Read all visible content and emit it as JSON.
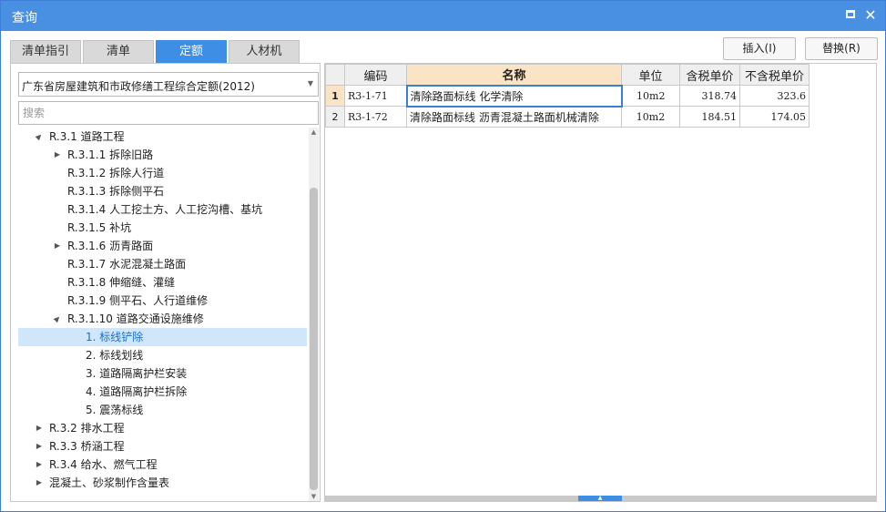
{
  "window": {
    "title": "查询"
  },
  "tabs": [
    {
      "label": "清单指引",
      "active": false
    },
    {
      "label": "清单",
      "active": false
    },
    {
      "label": "定额",
      "active": true
    },
    {
      "label": "人材机",
      "active": false
    }
  ],
  "toolbar": {
    "insert_label": "插入(I)",
    "replace_label": "替换(R)"
  },
  "left": {
    "library_select": "广东省房屋建筑和市政修缮工程综合定额(2012)",
    "search_placeholder": "搜索"
  },
  "tree": [
    {
      "label": "R.3.1 道路工程",
      "level": 1,
      "toggle": "expanded"
    },
    {
      "label": "R.3.1.1 拆除旧路",
      "level": 2,
      "toggle": "collapsed"
    },
    {
      "label": "R.3.1.2 拆除人行道",
      "level": 2,
      "toggle": "none"
    },
    {
      "label": "R.3.1.3 拆除侧平石",
      "level": 2,
      "toggle": "none"
    },
    {
      "label": "R.3.1.4 人工挖土方、人工挖沟槽、基坑",
      "level": 2,
      "toggle": "none"
    },
    {
      "label": "R.3.1.5 补坑",
      "level": 2,
      "toggle": "none"
    },
    {
      "label": "R.3.1.6 沥青路面",
      "level": 2,
      "toggle": "collapsed"
    },
    {
      "label": "R.3.1.7 水泥混凝土路面",
      "level": 2,
      "toggle": "none"
    },
    {
      "label": "R.3.1.8 伸缩缝、灌缝",
      "level": 2,
      "toggle": "none"
    },
    {
      "label": "R.3.1.9 侧平石、人行道维修",
      "level": 2,
      "toggle": "none"
    },
    {
      "label": "R.3.1.10 道路交通设施维修",
      "level": 2,
      "toggle": "expanded"
    },
    {
      "label": "1. 标线铲除",
      "level": 3,
      "toggle": "none",
      "selected": true
    },
    {
      "label": "2. 标线划线",
      "level": 3,
      "toggle": "none"
    },
    {
      "label": "3. 道路隔离护栏安装",
      "level": 3,
      "toggle": "none"
    },
    {
      "label": "4. 道路隔离护栏拆除",
      "level": 3,
      "toggle": "none"
    },
    {
      "label": "5. 震荡标线",
      "level": 3,
      "toggle": "none"
    },
    {
      "label": "R.3.2 排水工程",
      "level": 1,
      "toggle": "collapsed"
    },
    {
      "label": "R.3.3 桥涵工程",
      "level": 1,
      "toggle": "collapsed"
    },
    {
      "label": "R.3.4 给水、燃气工程",
      "level": 1,
      "toggle": "collapsed"
    },
    {
      "label": "混凝土、砂浆制作含量表",
      "level": 1,
      "toggle": "collapsed"
    }
  ],
  "grid": {
    "columns": [
      "编码",
      "名称",
      "单位",
      "含税单价",
      "不含税单价"
    ],
    "rows": [
      {
        "index": "1",
        "code": "R3-1-71",
        "name": "清除路面标线 化学清除",
        "unit": "10m2",
        "price_tax": "318.74",
        "price_notax": "323.6"
      },
      {
        "index": "2",
        "code": "R3-1-72",
        "name": "清除路面标线 沥青混凝土路面机械清除",
        "unit": "10m2",
        "price_tax": "184.51",
        "price_notax": "174.05"
      }
    ]
  },
  "icons": {
    "maximize": "maximize-icon",
    "close": "close-icon",
    "expanded": "▲",
    "collapsed": "▶",
    "dropdown": "▼",
    "scroll_up": "▲",
    "scroll_down": "▼",
    "hgrip": "▲"
  },
  "colors": {
    "title_bar": "#4a90e2",
    "active_tab": "#3f8ee6",
    "selected_row": "#cfe6fb",
    "header_highlight": "#fbe3c6"
  }
}
